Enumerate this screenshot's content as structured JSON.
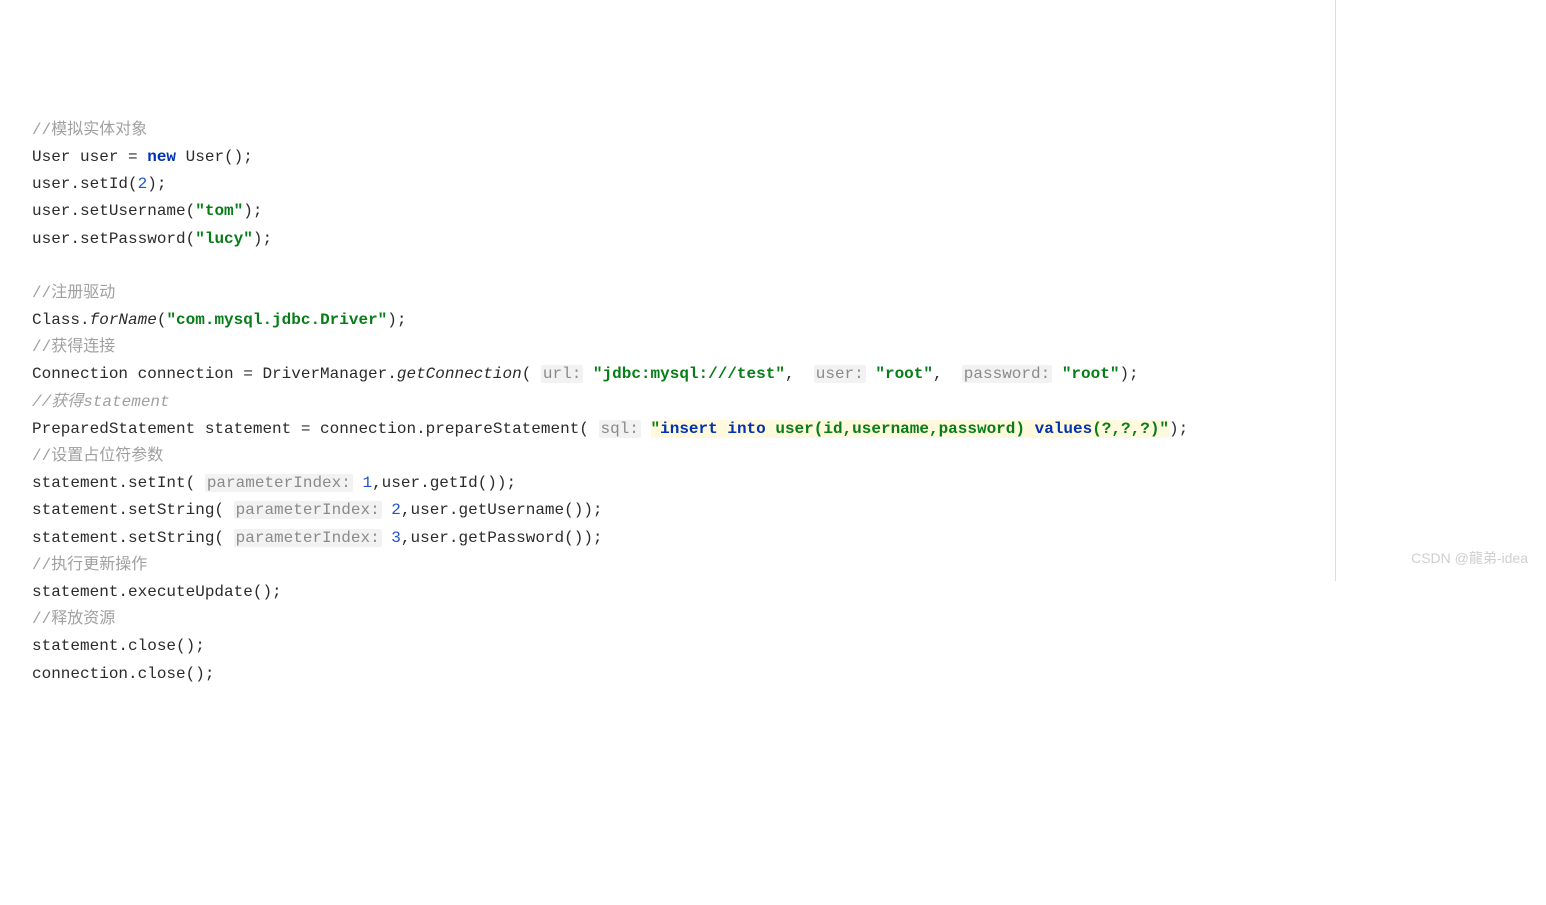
{
  "lines": {
    "c1": "//模拟实体对象",
    "l2a": "User user = ",
    "l2kw": "new",
    "l2b": " User();",
    "l3a": "user.setId(",
    "l3n": "2",
    "l3b": ");",
    "l4a": "user.setUsername(",
    "l4s": "\"tom\"",
    "l4b": ");",
    "l5a": "user.setPassword(",
    "l5s": "\"lucy\"",
    "l5b": ");",
    "c2": "//注册驱动",
    "l7a": "Class.",
    "l7m": "forName",
    "l7b": "(",
    "l7s": "\"com.mysql.jdbc.Driver\"",
    "l7c": ");",
    "c3": "//获得连接",
    "l9a": "Connection connection = DriverManager.",
    "l9m": "getConnection",
    "l9b": "( ",
    "l9h1": "url:",
    "l9sp1": " ",
    "l9s1": "\"jdbc:mysql:///test\"",
    "l9c1": ",  ",
    "l9h2": "user:",
    "l9sp2": " ",
    "l9s2": "\"root\"",
    "l9c2": ",  ",
    "l9h3": "password:",
    "l9sp3": " ",
    "l9s3": "\"root\"",
    "l9e": ");",
    "c4": "//获得statement",
    "l11a": "PreparedStatement statement = connection.prepareStatement( ",
    "l11h": "sql:",
    "l11sp": " ",
    "l11q1": "\"",
    "l11k1": "insert into ",
    "l11t1": "user(id,username,password) ",
    "l11k2": "values",
    "l11t2": "(?,?,?)",
    "l11q2": "\"",
    "l11e": ");",
    "c5": "//设置占位符参数",
    "l13a": "statement.setInt( ",
    "l13h": "parameterIndex:",
    "l13sp": " ",
    "l13n": "1",
    "l13b": ",user.getId());",
    "l14a": "statement.setString( ",
    "l14h": "parameterIndex:",
    "l14sp": " ",
    "l14n": "2",
    "l14b": ",user.getUsername());",
    "l15a": "statement.setString( ",
    "l15h": "parameterIndex:",
    "l15sp": " ",
    "l15n": "3",
    "l15b": ",user.getPassword());",
    "c6": "//执行更新操作",
    "l17": "statement.executeUpdate();",
    "c7": "//释放资源",
    "l19": "statement.close();",
    "l20": "connection.close();"
  },
  "watermark": "CSDN @龍弟-idea"
}
